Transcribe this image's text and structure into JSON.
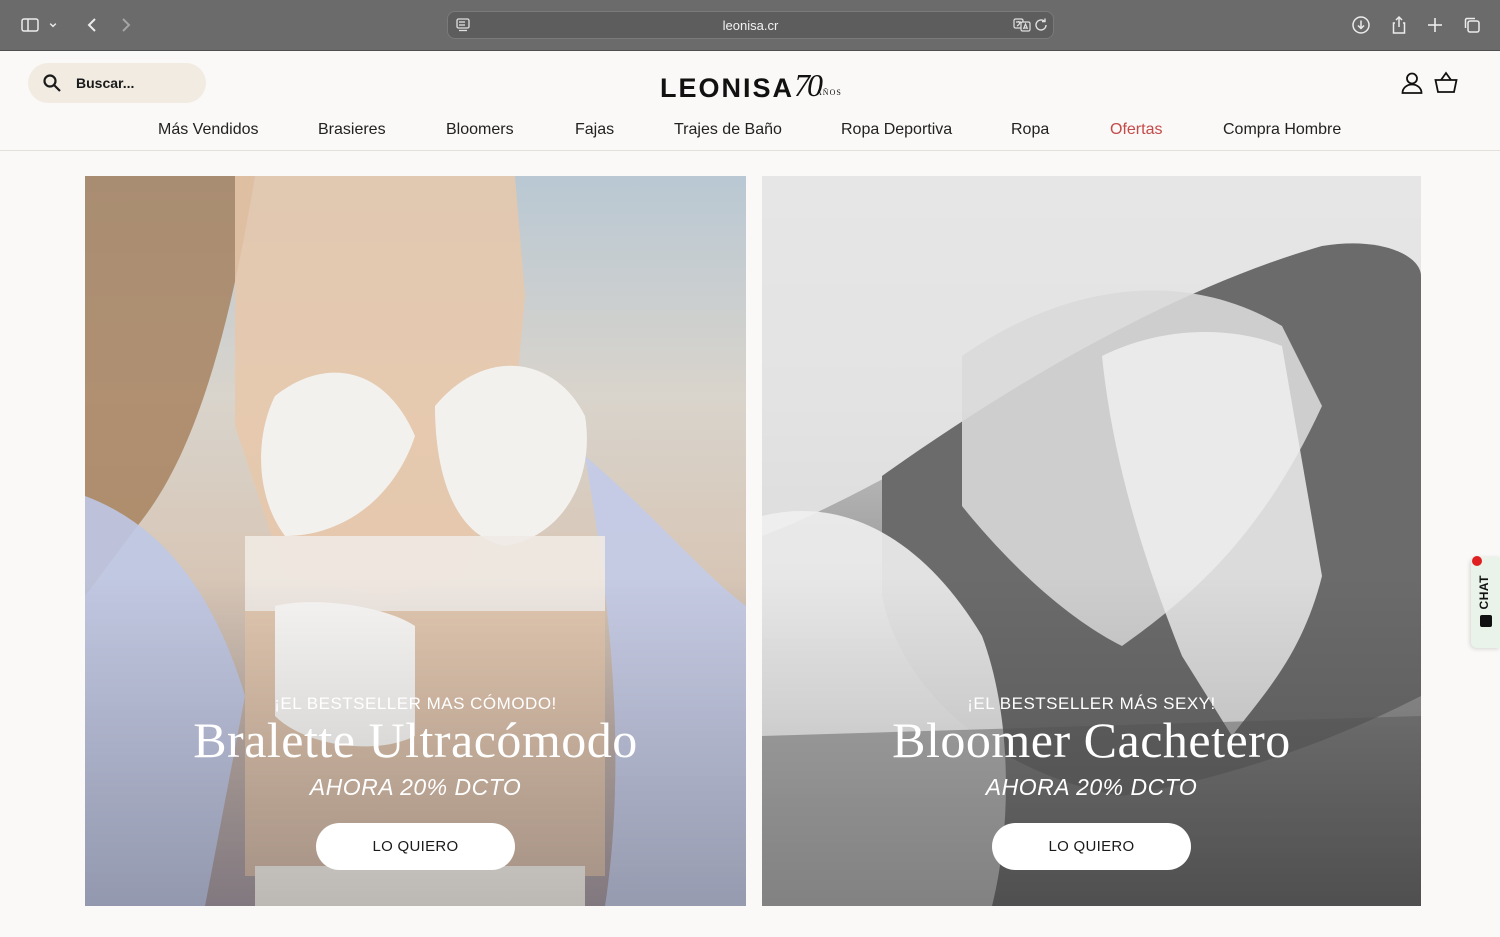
{
  "browser": {
    "url": "leonisa.cr"
  },
  "header": {
    "search_placeholder": "Buscar...",
    "brand": "LEONISA",
    "anniversary_number": "70",
    "anniversary_word": "AÑOS"
  },
  "nav": {
    "items": [
      {
        "label": "Más Vendidos"
      },
      {
        "label": "Brasieres"
      },
      {
        "label": "Bloomers"
      },
      {
        "label": "Fajas"
      },
      {
        "label": "Trajes de Baño"
      },
      {
        "label": "Ropa Deportiva"
      },
      {
        "label": "Ropa"
      },
      {
        "label": "Ofertas"
      },
      {
        "label": "Compra Hombre"
      }
    ],
    "sale_color": "#c44a4a"
  },
  "hero": {
    "left": {
      "kicker": "¡EL BESTSELLER MAS CÓMODO!",
      "title": "Bralette Ultracómodo",
      "promo": "AHORA 20% DCTO",
      "cta": "LO QUIERO"
    },
    "right": {
      "kicker": "¡EL BESTSELLER MÁS SEXY!",
      "title": "Bloomer Cachetero",
      "promo": "AHORA 20% DCTO",
      "cta": "LO QUIERO"
    }
  },
  "chat": {
    "label": "CHAT",
    "badge_color": "#e02020"
  }
}
